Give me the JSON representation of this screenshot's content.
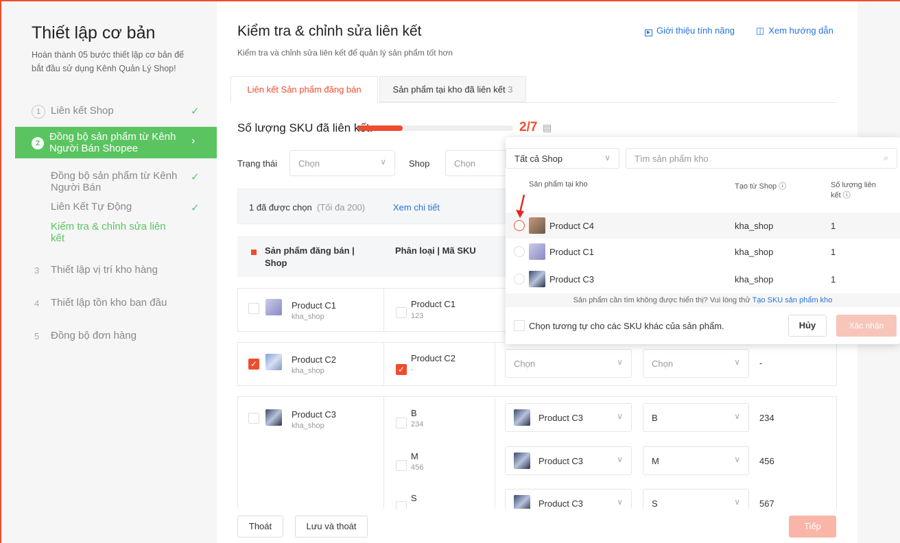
{
  "sidebar": {
    "title": "Thiết lập cơ bản",
    "desc1": "Hoàn thành 05 bước thiết lập cơ bản để",
    "desc2": "bắt đầu sử dụng Kênh Quản Lý Shop!",
    "step1": "Liên kết Shop",
    "step2a": "Đồng bộ sản phẩm từ Kênh",
    "step2b": "Người Bán Shopee",
    "sub1a": "Đồng bộ sản phẩm từ Kênh",
    "sub1b": "Người Bán",
    "sub2": "Liên Kết Tự Động",
    "sub3a": "Kiểm tra & chỉnh sửa liên",
    "sub3b": "kết",
    "step3": "Thiết lập vị trí kho hàng",
    "step4": "Thiết lập tồn kho ban đầu",
    "step5": "Đồng bộ đơn hàng"
  },
  "header": {
    "title": "Kiểm tra & chỉnh sửa liên kết",
    "subtitle": "Kiểm tra và chỉnh sửa liên kết để quản lý sản phẩm tốt hơn",
    "intro": "Giới thiệu tính năng",
    "guide": "Xem hướng dẫn"
  },
  "tabs": {
    "tab1": "Liên kết Sản phẩm đăng bán",
    "tab2": "Sản phẩm tại kho đã liên kết",
    "tab2_count": "3"
  },
  "sku": {
    "label": "Số lượng SKU đã liên kết:",
    "value": "2/7",
    "progress": 0.2857
  },
  "filters": {
    "status_label": "Trạng thái",
    "status_ph": "Chọn",
    "shop_label": "Shop",
    "shop_ph": "Chọn"
  },
  "selection": {
    "count": "1 đã được chọn",
    "max": "(Tối đa 200)",
    "detail": "Xem chi tiết"
  },
  "table": {
    "col1a": "Sản phẩm đăng bán |",
    "col1b": "Shop",
    "col2": "Phân loại | Mã SKU"
  },
  "rows": {
    "c1": {
      "name": "Product C1",
      "shop": "kha_shop",
      "var": "Product C1",
      "code": "123"
    },
    "c2": {
      "name": "Product C2",
      "shop": "kha_shop",
      "var": "Product C2",
      "code": "-",
      "sel1": "Chọn",
      "sel2": "Chọn",
      "qty": "-"
    },
    "c3": {
      "name": "Product C3",
      "shop": "kha_shop",
      "b": {
        "var": "B",
        "code": "234",
        "prod": "Product C3",
        "opt": "B",
        "qty": "234"
      },
      "m": {
        "var": "M",
        "code": "456",
        "prod": "Product C3",
        "opt": "M",
        "qty": "456"
      },
      "s": {
        "var": "S",
        "prod": "Product C3",
        "opt": "S",
        "qty": "567"
      }
    }
  },
  "popup": {
    "shop_select": "Tất cả Shop",
    "search_ph": "Tìm sản phẩm kho",
    "col1": "Sản phẩm tại kho",
    "col2": "Tạo từ Shop",
    "col3a": "Số lượng liên",
    "col3b": "kết",
    "items": [
      {
        "name": "Product C4",
        "shop": "kha_shop",
        "qty": "1"
      },
      {
        "name": "Product C1",
        "shop": "kha_shop",
        "qty": "1"
      },
      {
        "name": "Product C3",
        "shop": "kha_shop",
        "qty": "1"
      }
    ],
    "hint": "Sản phẩm cần tìm không được hiển thị? Vui lòng thử",
    "hint_link": "Tạo SKU sản phẩm kho",
    "same": "Chọn tương tự cho các SKU khác của sản phẩm.",
    "cancel": "Hủy",
    "confirm": "Xác nhận"
  },
  "footer": {
    "exit": "Thoát",
    "save_exit": "Lưu và thoát",
    "next": "Tiếp"
  },
  "colors": {
    "accent": "#ee4d2d",
    "green": "#5ac461",
    "link": "#2673dd"
  }
}
